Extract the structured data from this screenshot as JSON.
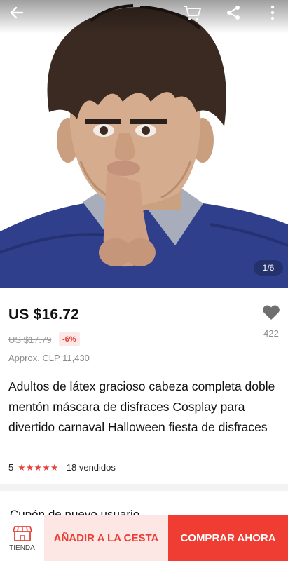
{
  "product_image": {
    "counter": "1/6",
    "description_icon": "latex-mask-photo"
  },
  "topbar": {
    "back_icon": "arrow-left-icon",
    "cart_icon": "cart-icon",
    "share_icon": "share-icon",
    "more_icon": "more-vertical-icon"
  },
  "price": {
    "current": "US $16.72",
    "original": "US $17.79",
    "discount": "-6%",
    "approx": "Approx. CLP 11,430"
  },
  "wishlist": {
    "count": "422"
  },
  "product": {
    "title": "Adultos de látex gracioso cabeza completa doble mentón máscara de disfraces Cosplay para divertido carnaval Halloween fiesta de disfraces",
    "rating": "5",
    "stars": "★★★★★",
    "sold": "18 vendidos"
  },
  "coupon": {
    "title": "Cupón de nuevo usuario"
  },
  "bottom_bar": {
    "store_label": "TIENDA",
    "add_to_cart": "AÑADIR A LA CESTA",
    "buy_now": "COMPRAR AHORA"
  },
  "colors": {
    "accent": "#ef3d33",
    "accent_light": "#fde7e4",
    "discount_bg": "#fde8e8",
    "shirt": "#2f3f8c"
  }
}
